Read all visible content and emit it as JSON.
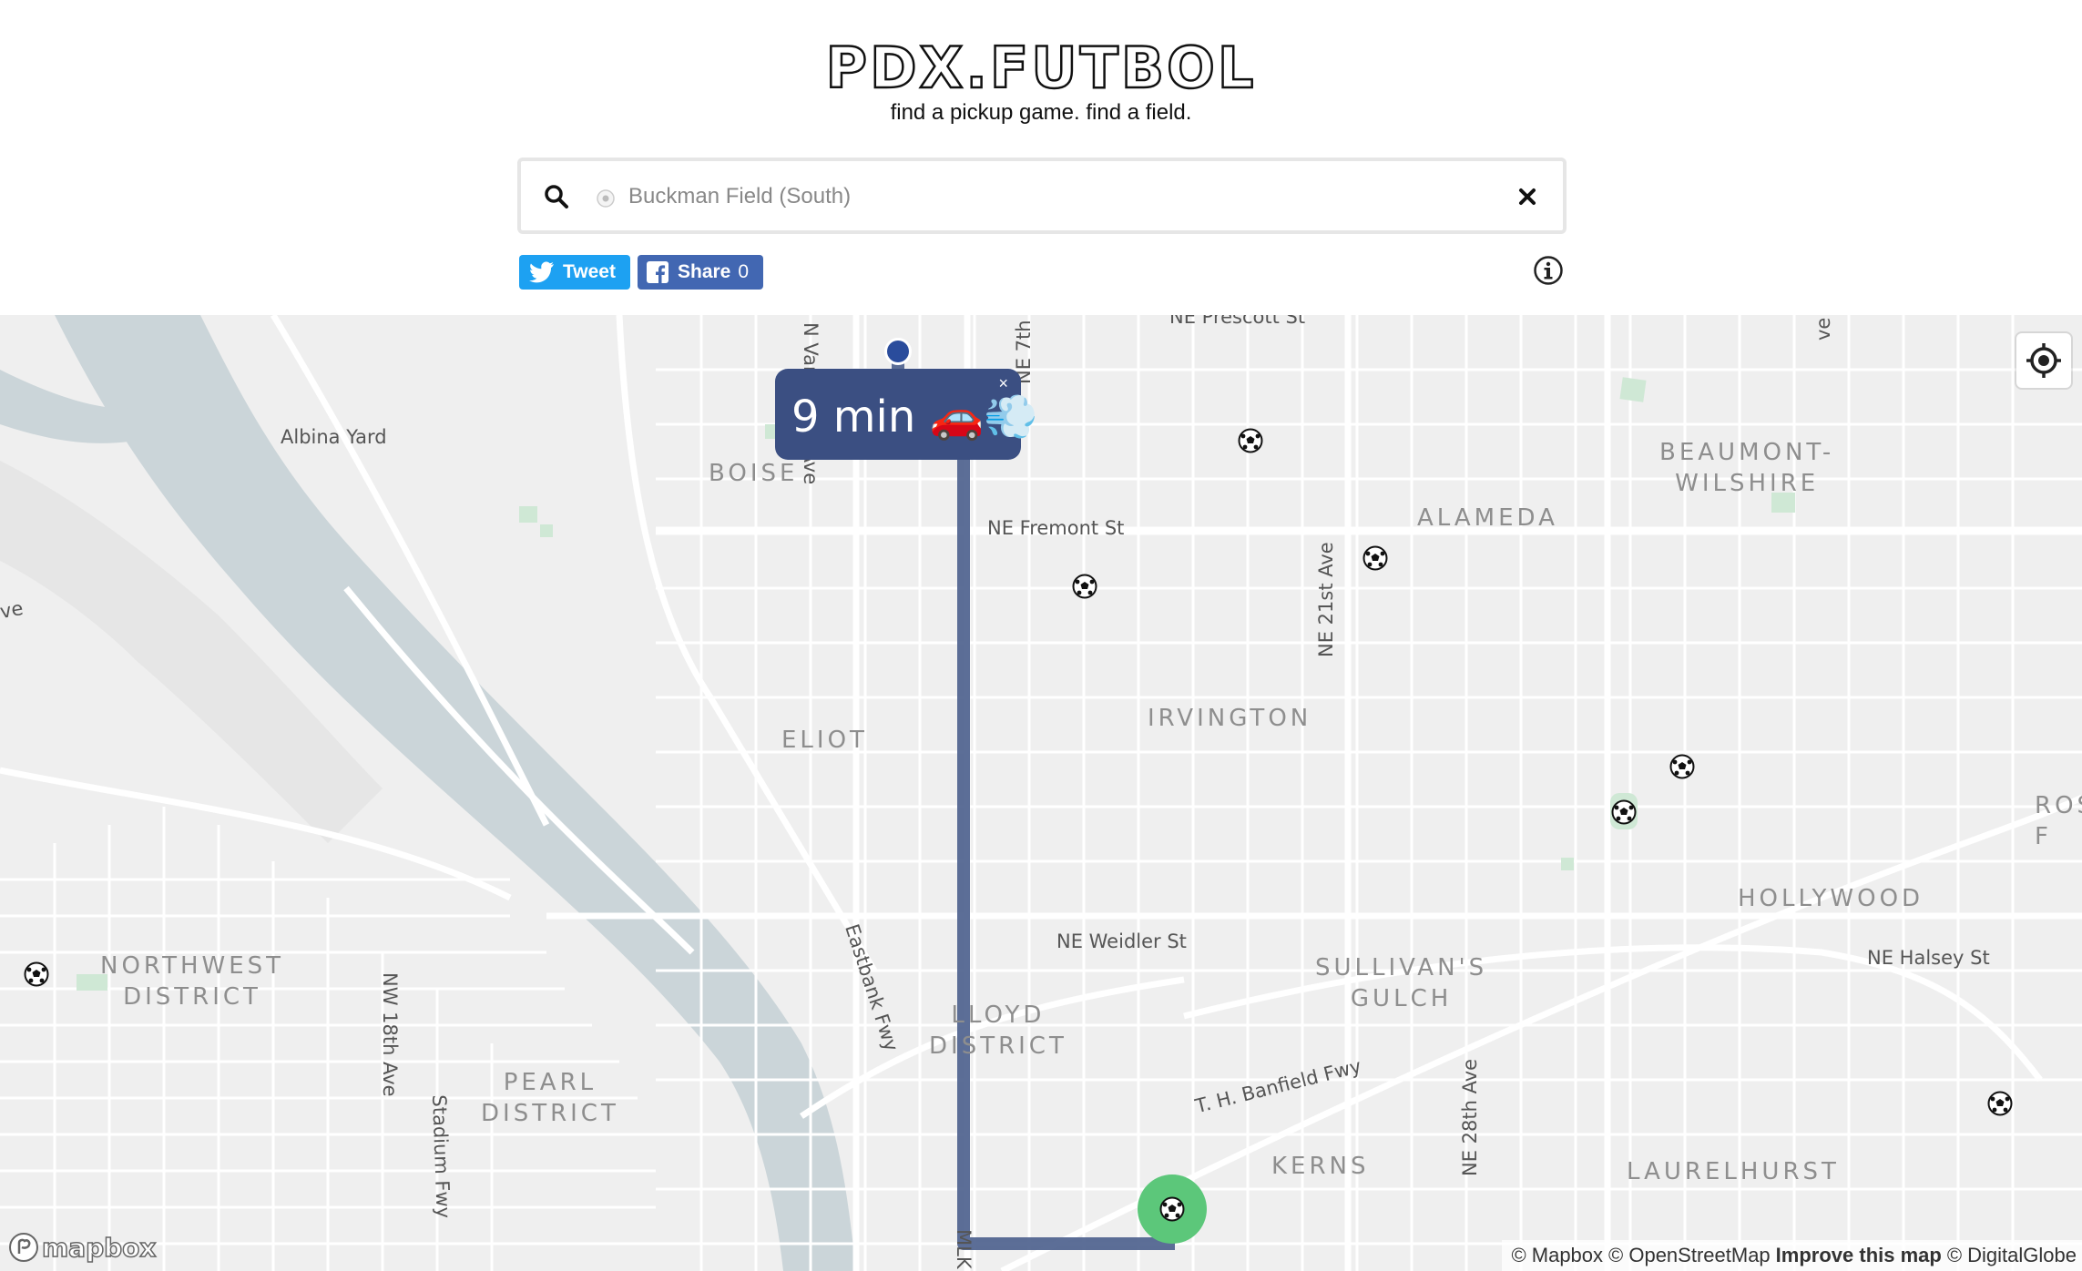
{
  "header": {
    "logo": "PDX.FUTBOL",
    "tagline": "find a pickup game. find a field."
  },
  "search": {
    "value": "",
    "placeholder": "Buckman Field (South)",
    "search_icon": "search-icon",
    "clear_icon": "close-icon"
  },
  "share": {
    "tweet_label": "Tweet",
    "facebook_label": "Share",
    "facebook_count": "0"
  },
  "map": {
    "neighborhoods": {
      "boise": "BOISE",
      "beaumont": "BEAUMONT-\nWILSHIRE",
      "alameda": "ALAMEDA",
      "eliot": "ELIOT",
      "irvington": "IRVINGTON",
      "hollywood": "HOLLYWOOD",
      "sullivans": "SULLIVAN'S\nGULCH",
      "lloyd": "LLOYD\nDISTRICT",
      "northwest": "NORTHWEST\nDISTRICT",
      "pearl": "PEARL\nDISTRICT",
      "kerns": "KERNS",
      "laurelhurst": "LAURELHURST",
      "ros": "ROS\nF"
    },
    "streets": {
      "prescott": "NE Prescott St",
      "albina": "Albina Yard",
      "vancouver": "N Vancouver Ave",
      "ne7th": "NE 7th",
      "fremont": "NE Fremont St",
      "ne21st": "NE 21st Ave",
      "eastbank": "Eastbank Fwy",
      "weidler": "NE Weidler St",
      "halsey": "NE Halsey St",
      "nw18th": "NW 18th Ave",
      "stadium": "Stadium Fwy",
      "banfield": "T. H. Banfield Fwy",
      "ne28th": "NE 28th Ave",
      "mlk": "MLK",
      "ve": "ve",
      "ave_right": "ve"
    },
    "route": {
      "duration": "9 min 🚗💨",
      "close": "×"
    },
    "colors": {
      "route": "#4a5e8c",
      "destination": "#5cc77a",
      "origin": "#2a4c9c",
      "water": "#cbd5d9",
      "park": "#cfe8d5"
    },
    "attribution": {
      "mapbox": "© Mapbox",
      "osm": "© OpenStreetMap",
      "improve": "Improve this map",
      "digitalglobe": "© DigitalGlobe"
    },
    "logo": "mapbox"
  }
}
